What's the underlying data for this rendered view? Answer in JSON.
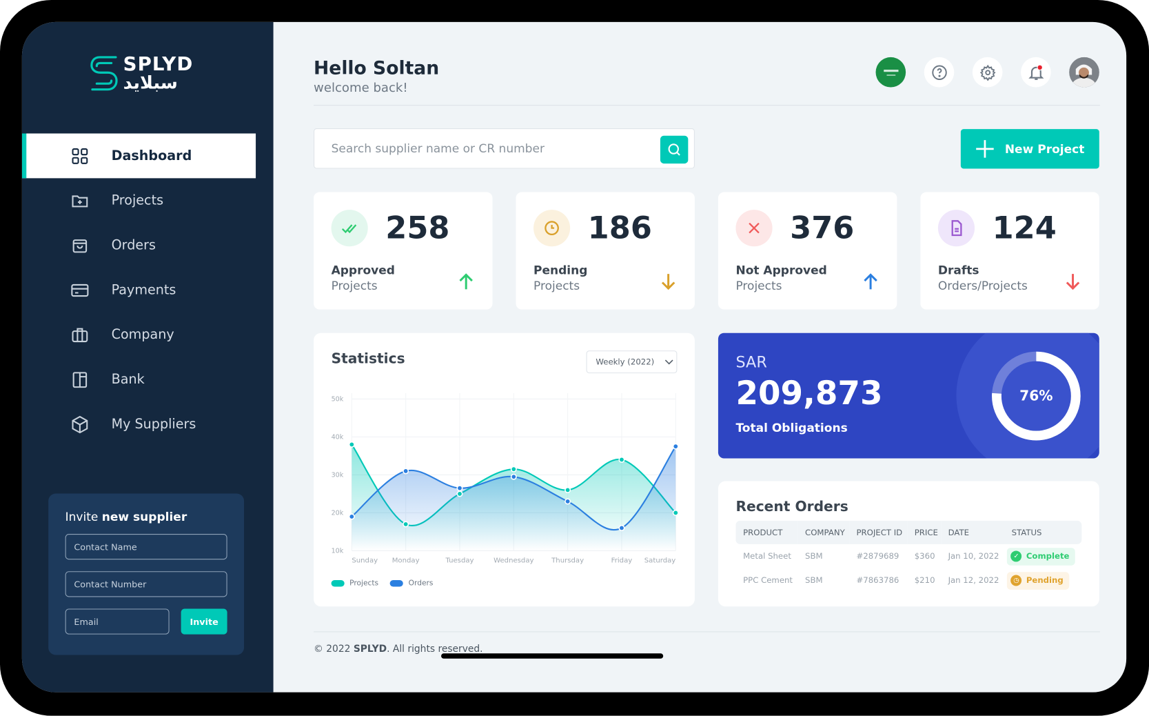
{
  "brand": {
    "name_en": "SPLYD",
    "name_ar": "سبلايد",
    "accent": "#00c9b7",
    "sidebar_bg": "#14283f"
  },
  "sidebar": {
    "items": [
      {
        "label": "Dashboard",
        "icon": "grid-icon",
        "active": true
      },
      {
        "label": "Projects",
        "icon": "folder-plus-icon"
      },
      {
        "label": "Orders",
        "icon": "shopping-bag-icon"
      },
      {
        "label": "Payments",
        "icon": "credit-card-icon"
      },
      {
        "label": "Company",
        "icon": "briefcase-icon"
      },
      {
        "label": "Bank",
        "icon": "bank-icon"
      },
      {
        "label": "My Suppliers",
        "icon": "cube-icon"
      }
    ]
  },
  "invite": {
    "title_prefix": "Invite",
    "title_bold": "new supplier",
    "contact_name_placeholder": "Contact Name",
    "contact_number_placeholder": "Contact Number",
    "email_placeholder": "Email",
    "button": "Invite"
  },
  "header": {
    "greeting": "Hello Soltan",
    "subtitle": "welcome back!",
    "notification_dot": true
  },
  "search": {
    "placeholder": "Search supplier name or CR number"
  },
  "new_project": "New Project",
  "stats": [
    {
      "value": "258",
      "label1": "Approved",
      "label2": "Projects",
      "trend": "up",
      "color": "#2ecc71"
    },
    {
      "value": "186",
      "label1": "Pending",
      "label2": "Projects",
      "trend": "down",
      "color": "#d9a02b"
    },
    {
      "value": "376",
      "label1": "Not Approved",
      "label2": "Projects",
      "trend": "up",
      "color": "#2b7fe0"
    },
    {
      "value": "124",
      "label1": "Drafts",
      "label2": "Orders/Projects",
      "trend": "down",
      "color": "#f05a5a"
    }
  ],
  "statistics": {
    "title": "Statistics",
    "period": "Weekly (2022)"
  },
  "chart_data": {
    "type": "area",
    "categories": [
      "Sunday",
      "Monday",
      "Tuesday",
      "Wednesday",
      "Thursday",
      "Friday",
      "Saturday"
    ],
    "yticks": [
      "10k",
      "20k",
      "30k",
      "40k",
      "50k"
    ],
    "ylim": [
      10000,
      50000
    ],
    "grid": true,
    "legend": "bottom-left",
    "series": [
      {
        "name": "Projects",
        "color": "#00c9b7",
        "values": [
          38000,
          17000,
          25000,
          31500,
          26000,
          34000,
          20000
        ]
      },
      {
        "name": "Orders",
        "color": "#2b7fe0",
        "values": [
          19000,
          31000,
          26500,
          29500,
          23000,
          16000,
          37500
        ]
      }
    ]
  },
  "obligations": {
    "currency": "SAR",
    "amount": "209,873",
    "label": "Total Obligations",
    "percent": 76,
    "percent_label": "76%"
  },
  "recent_orders": {
    "title": "Recent Orders",
    "columns": [
      "PRODUCT",
      "COMPANY",
      "PROJECT ID",
      "PRICE",
      "DATE",
      "STATUS"
    ],
    "rows": [
      {
        "product": "Metal Sheet",
        "company": "SBM",
        "project_id": "#2879689",
        "price": "$360",
        "date": "Jan 10, 2022",
        "status": "Complete"
      },
      {
        "product": "PPC Cement",
        "company": "SBM",
        "project_id": "#7863786",
        "price": "$210",
        "date": "Jan 12, 2022",
        "status": "Pending"
      }
    ]
  },
  "footer": {
    "prefix": "© 2022",
    "brand": "SPLYD",
    "suffix": ". All rights reserved."
  }
}
